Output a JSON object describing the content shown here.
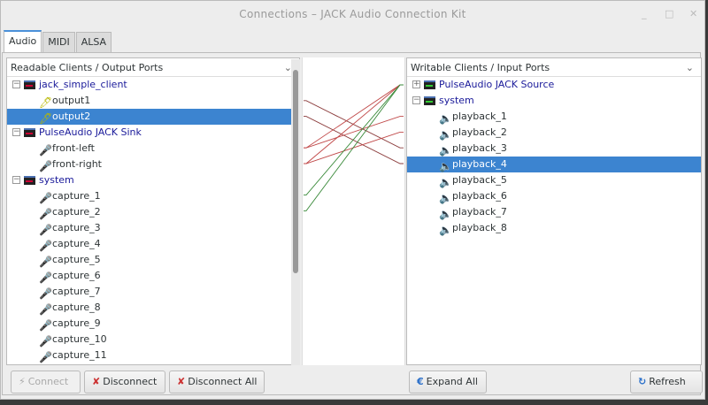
{
  "window": {
    "title": "Connections – JACK Audio Connection Kit",
    "minimize": "_",
    "maximize": "□",
    "close": "✕"
  },
  "tabs": [
    {
      "label": "Audio",
      "active": true
    },
    {
      "label": "MIDI"
    },
    {
      "label": "ALSA"
    }
  ],
  "left": {
    "header": "Readable Clients / Output Ports",
    "rows": [
      {
        "type": "client",
        "label": "jack_simple_client",
        "exp": "−"
      },
      {
        "type": "port",
        "label": "output1",
        "icon": "plug-icon"
      },
      {
        "type": "port",
        "label": "output2",
        "icon": "plug-icon",
        "selected": true
      },
      {
        "type": "client",
        "label": "PulseAudio JACK Sink",
        "exp": "−"
      },
      {
        "type": "port",
        "label": "front-left",
        "icon": "microphone-icon"
      },
      {
        "type": "port",
        "label": "front-right",
        "icon": "microphone-icon"
      },
      {
        "type": "client",
        "label": "system",
        "exp": "−"
      },
      {
        "type": "port",
        "label": "capture_1",
        "icon": "microphone-icon"
      },
      {
        "type": "port",
        "label": "capture_2",
        "icon": "microphone-icon"
      },
      {
        "type": "port",
        "label": "capture_3",
        "icon": "microphone-icon"
      },
      {
        "type": "port",
        "label": "capture_4",
        "icon": "microphone-icon"
      },
      {
        "type": "port",
        "label": "capture_5",
        "icon": "microphone-icon"
      },
      {
        "type": "port",
        "label": "capture_6",
        "icon": "microphone-icon"
      },
      {
        "type": "port",
        "label": "capture_7",
        "icon": "microphone-icon"
      },
      {
        "type": "port",
        "label": "capture_8",
        "icon": "microphone-icon"
      },
      {
        "type": "port",
        "label": "capture_9",
        "icon": "microphone-icon"
      },
      {
        "type": "port",
        "label": "capture_10",
        "icon": "microphone-icon"
      },
      {
        "type": "port",
        "label": "capture_11",
        "icon": "microphone-icon"
      }
    ]
  },
  "right": {
    "header": "Writable Clients / Input Ports",
    "rows": [
      {
        "type": "client",
        "label": "PulseAudio JACK Source",
        "exp": "+"
      },
      {
        "type": "client",
        "label": "system",
        "exp": "−"
      },
      {
        "type": "port",
        "label": "playback_1",
        "icon": "speaker-icon"
      },
      {
        "type": "port",
        "label": "playback_2",
        "icon": "speaker-icon"
      },
      {
        "type": "port",
        "label": "playback_3",
        "icon": "speaker-icon"
      },
      {
        "type": "port",
        "label": "playback_4",
        "icon": "speaker-icon",
        "selected": true
      },
      {
        "type": "port",
        "label": "playback_5",
        "icon": "speaker-icon"
      },
      {
        "type": "port",
        "label": "playback_6",
        "icon": "speaker-icon"
      },
      {
        "type": "port",
        "label": "playback_7",
        "icon": "speaker-icon"
      },
      {
        "type": "port",
        "label": "playback_8",
        "icon": "speaker-icon"
      }
    ]
  },
  "connections": [
    {
      "from": 1,
      "to": 4,
      "color": "#8a3a3a"
    },
    {
      "from": 2,
      "to": 5,
      "color": "#8a3a3a"
    },
    {
      "from": 4,
      "to": 0,
      "color": "#c04848"
    },
    {
      "from": 4,
      "to": 2,
      "color": "#c04848"
    },
    {
      "from": 5,
      "to": 0,
      "color": "#c04848"
    },
    {
      "from": 5,
      "to": 3,
      "color": "#c04848"
    },
    {
      "from": 7,
      "to": 0,
      "color": "#3a8a3a"
    },
    {
      "from": 8,
      "to": 0,
      "color": "#3a8a3a"
    }
  ],
  "buttons": {
    "connect": "Connect",
    "disconnect": "Disconnect",
    "disconnect_all": "Disconnect All",
    "expand_all": "Expand All",
    "refresh": "Refresh"
  }
}
